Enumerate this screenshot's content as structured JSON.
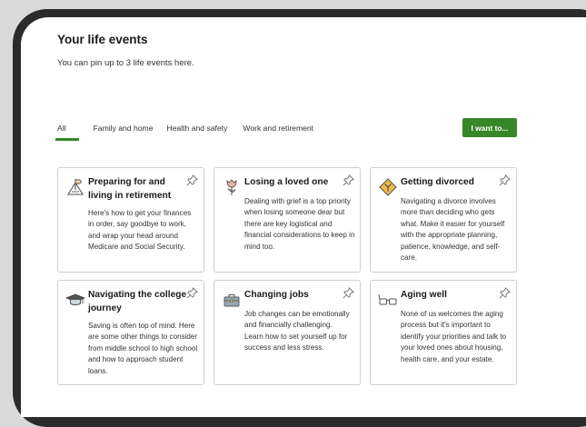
{
  "header": {
    "title": "Your life events",
    "subtitle": "You can pin up to 3 life events here."
  },
  "tabs": [
    {
      "label": "All",
      "active": true
    },
    {
      "label": "Family and home",
      "active": false
    },
    {
      "label": "Health and safety",
      "active": false
    },
    {
      "label": "Work and retirement",
      "active": false
    }
  ],
  "actions": {
    "want_label": "I want to..."
  },
  "colors": {
    "accent": "#368727",
    "icon_orange": "#f2b84b",
    "icon_rose": "#e8a0a0"
  },
  "cards": [
    {
      "title": "Preparing for and living in retirement",
      "icon": "signpost-icon",
      "body": "Here's how to get your finances in order, say goodbye to work, and wrap your head around Medicare and Social Security."
    },
    {
      "title": "Losing a loved one",
      "icon": "flower-icon",
      "body": "Dealing with grief is a top priority when losing someone dear but there are key logistical and financial considerations to keep in mind too."
    },
    {
      "title": "Getting divorced",
      "icon": "diverging-road-sign-icon",
      "body": "Navigating a divorce involves more than deciding who gets what. Make it easier for yourself with the appropriate planning, patience, knowledge, and self-care."
    },
    {
      "title": "Navigating the college journey",
      "icon": "graduation-cap-icon",
      "body": "Saving is often top of mind. Here are some other things to consider from middle school to high school and how to approach student loans."
    },
    {
      "title": "Changing jobs",
      "icon": "briefcase-icon",
      "body": "Job changes can be emotionally and financially challenging. Learn how to set yourself up for success and less stress."
    },
    {
      "title": "Aging well",
      "icon": "eyeglasses-icon",
      "body": "None of us welcomes the aging process but it's important to identify your priorities and talk to your loved ones about housing, health care, and your estate."
    }
  ]
}
